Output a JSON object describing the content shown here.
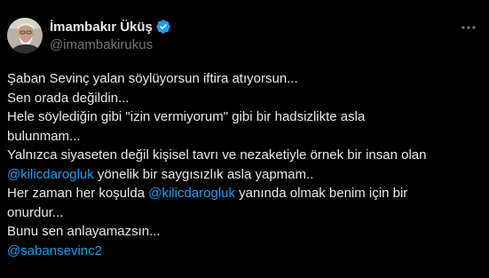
{
  "author": {
    "display_name": "İmambakır Üküş",
    "handle": "@imambakirukus",
    "verified_color": "#1d9bf0"
  },
  "menu": {
    "icon": "more-horizontal-icon"
  },
  "tweet": {
    "line1": "Şaban Sevinç yalan söylüyorsun iftira atıyorsun...",
    "line2": "Sen orada değildin...",
    "line3": "Hele söylediğin gibi \"izin vermiyorum\" gibi bir hadsizlikte asla",
    "line4": "bulunmam...",
    "line5": "Yalnızca siyaseten değil kişisel tavrı ve nezaketiyle örnek bir insan olan",
    "line6_mention": "@kilicdarogluk",
    "line6_text": " yönelik bir saygısızlık asla yapmam..",
    "line7_pre": "Her zaman her koşulda ",
    "line7_mention": "@kilicdarogluk",
    "line7_post": " yanında olmak benim için bir",
    "line8": "onurdur...",
    "line9": "Bunu sen anlayamazsın...",
    "line10_mention": "@sabansevinc2"
  },
  "colors": {
    "background": "#000000",
    "text": "#e7e9ea",
    "secondary": "#71767b",
    "link": "#1d9bf0"
  }
}
